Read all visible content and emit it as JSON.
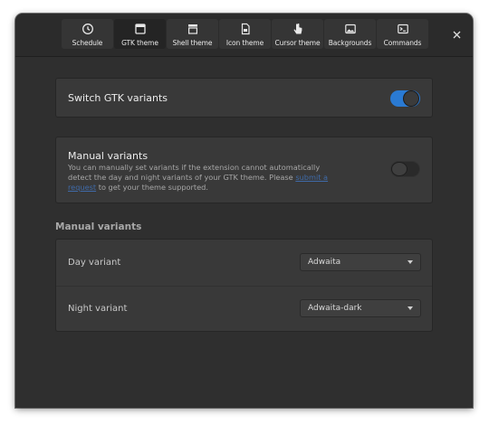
{
  "tabs": [
    {
      "label": "Schedule",
      "icon": "clock-icon",
      "active": false
    },
    {
      "label": "GTK theme",
      "icon": "window-icon",
      "active": true
    },
    {
      "label": "Shell theme",
      "icon": "panel-icon",
      "active": false
    },
    {
      "label": "Icon theme",
      "icon": "document-icon",
      "active": false
    },
    {
      "label": "Cursor theme",
      "icon": "pointer-hand-icon",
      "active": false
    },
    {
      "label": "Backgrounds",
      "icon": "image-icon",
      "active": false
    },
    {
      "label": "Commands",
      "icon": "terminal-icon",
      "active": false
    }
  ],
  "switch_gtk": {
    "label": "Switch GTK variants",
    "enabled": true
  },
  "manual": {
    "title": "Manual variants",
    "desc_before": "You can manually set variants if the extension cannot automatically detect the day and night variants of your GTK theme. Please ",
    "desc_link": "submit a request",
    "desc_after": " to get your theme supported.",
    "enabled": false
  },
  "manual_section": {
    "title": "Manual variants",
    "day_label": "Day variant",
    "day_value": "Adwaita",
    "night_label": "Night variant",
    "night_value": "Adwaita-dark"
  },
  "colors": {
    "accent": "#2a7ad3",
    "window_bg": "#2f2f2f",
    "card_bg": "#393939",
    "link": "#3f6aa8"
  }
}
